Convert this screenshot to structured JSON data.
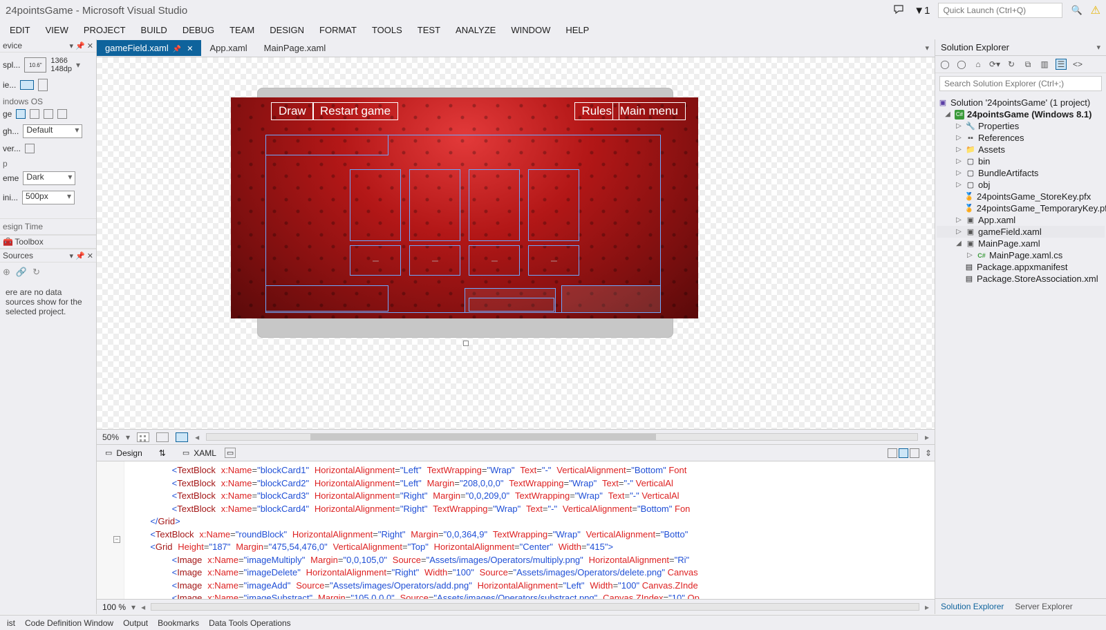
{
  "title": "24pointsGame - Microsoft Visual Studio",
  "quicklaunch_placeholder": "Quick Launch (Ctrl+Q)",
  "notifications": "1",
  "menus": [
    "EDIT",
    "VIEW",
    "PROJECT",
    "BUILD",
    "DEBUG",
    "TEAM",
    "DESIGN",
    "FORMAT",
    "TOOLS",
    "TEST",
    "ANALYZE",
    "WINDOW",
    "HELP"
  ],
  "doctabs": [
    {
      "label": "gameField.xaml",
      "active": true
    },
    {
      "label": "App.xaml",
      "active": false
    },
    {
      "label": "MainPage.xaml",
      "active": false
    }
  ],
  "left": {
    "device_hdr": "evice",
    "display_label": "spl...",
    "device_size": "10.6\"",
    "device_res": "1366",
    "device_dp": "148dp",
    "orient_label": "ie...",
    "os_hdr": "indows OS",
    "edge_label": "ge",
    "high_label": "gh...",
    "high_value": "Default",
    "over_label": "ver...",
    "app_hdr": "p",
    "theme_label": "eme",
    "theme_value": "Dark",
    "min_label": "ini...",
    "min_value": "500px",
    "design_hdr": "esign Time",
    "toolbox_label": "Toolbox",
    "sources_hdr": "Sources",
    "sources_msg": "ere are no data sources show for the selected project."
  },
  "game": {
    "draw": "Draw",
    "restart": "Restart game",
    "rules": "Rules",
    "mainmenu": "Main menu"
  },
  "zoom": {
    "pct": "50%"
  },
  "split": {
    "design": "Design",
    "xaml": "XAML"
  },
  "codebtm_pct": "100 %",
  "xaml_lines": [
    {
      "indent": 8,
      "el": "TextBlock",
      "attrs": [
        [
          "x:Name",
          "blockCard1"
        ],
        [
          "HorizontalAlignment",
          "Left"
        ],
        [
          "TextWrapping",
          "Wrap"
        ],
        [
          "Text",
          "-"
        ],
        [
          "VerticalAlignment",
          "Bottom"
        ]
      ],
      "tail": " Font"
    },
    {
      "indent": 8,
      "el": "TextBlock",
      "attrs": [
        [
          "x:Name",
          "blockCard2"
        ],
        [
          "HorizontalAlignment",
          "Left"
        ],
        [
          "Margin",
          "208,0,0,0"
        ],
        [
          "TextWrapping",
          "Wrap"
        ],
        [
          "Text",
          "-"
        ]
      ],
      "tail": " VerticalAl"
    },
    {
      "indent": 8,
      "el": "TextBlock",
      "attrs": [
        [
          "x:Name",
          "blockCard3"
        ],
        [
          "HorizontalAlignment",
          "Right"
        ],
        [
          "Margin",
          "0,0,209,0"
        ],
        [
          "TextWrapping",
          "Wrap"
        ],
        [
          "Text",
          "-"
        ]
      ],
      "tail": " VerticalAl"
    },
    {
      "indent": 8,
      "el": "TextBlock",
      "attrs": [
        [
          "x:Name",
          "blockCard4"
        ],
        [
          "HorizontalAlignment",
          "Right"
        ],
        [
          "TextWrapping",
          "Wrap"
        ],
        [
          "Text",
          "-"
        ],
        [
          "VerticalAlignment",
          "Bottom"
        ]
      ],
      "tail": " Fon"
    },
    {
      "indent": 4,
      "close": "Grid"
    },
    {
      "indent": 4,
      "el": "TextBlock",
      "attrs": [
        [
          "x:Name",
          "roundBlock"
        ],
        [
          "HorizontalAlignment",
          "Right"
        ],
        [
          "Margin",
          "0,0,364,9"
        ],
        [
          "TextWrapping",
          "Wrap"
        ],
        [
          "VerticalAlignment",
          "Botto"
        ]
      ],
      "tail": ""
    },
    {
      "indent": 4,
      "el": "Grid",
      "attrs": [
        [
          "Height",
          "187"
        ],
        [
          "Margin",
          "475,54,476,0"
        ],
        [
          "VerticalAlignment",
          "Top"
        ],
        [
          "HorizontalAlignment",
          "Center"
        ],
        [
          "Width",
          "415"
        ]
      ],
      "open": true
    },
    {
      "indent": 8,
      "el": "Image",
      "attrs": [
        [
          "x:Name",
          "imageMultiply"
        ],
        [
          "Margin",
          "0,0,105,0"
        ],
        [
          "Source",
          "Assets/images/Operators/multiply.png"
        ],
        [
          "HorizontalAlignment",
          "Ri"
        ]
      ],
      "tail": ""
    },
    {
      "indent": 8,
      "el": "Image",
      "attrs": [
        [
          "x:Name",
          "imageDelete"
        ],
        [
          "HorizontalAlignment",
          "Right"
        ],
        [
          "Width",
          "100"
        ],
        [
          "Source",
          "Assets/images/Operators/delete.png"
        ]
      ],
      "tail": " Canvas"
    },
    {
      "indent": 8,
      "el": "Image",
      "attrs": [
        [
          "x:Name",
          "imageAdd"
        ],
        [
          "Source",
          "Assets/images/Operators/add.png"
        ],
        [
          "HorizontalAlignment",
          "Left"
        ],
        [
          "Width",
          "100"
        ]
      ],
      "tail": " Canvas.ZInde"
    },
    {
      "indent": 8,
      "el": "Image",
      "attrs": [
        [
          "x:Name",
          "imageSubstract"
        ],
        [
          "Margin",
          "105,0,0,0"
        ],
        [
          "Source",
          "Assets/images/Operators/substract.png"
        ],
        [
          "Canvas.ZIndex",
          "10"
        ]
      ],
      "tail": " Op"
    }
  ],
  "se": {
    "title": "Solution Explorer",
    "search_placeholder": "Search Solution Explorer (Ctrl+;)",
    "solution": "Solution '24pointsGame' (1 project)",
    "project": "24pointsGame (Windows 8.1)",
    "nodes": {
      "properties": "Properties",
      "references": "References",
      "assets": "Assets",
      "bin": "bin",
      "bundle": "BundleArtifacts",
      "obj": "obj",
      "storekey": "24pointsGame_StoreKey.pfx",
      "tempkey": "24pointsGame_TemporaryKey.pfx",
      "appxaml": "App.xaml",
      "gamefield": "gameField.xaml",
      "mainpage": "MainPage.xaml",
      "mainpagecs": "MainPage.xaml.cs",
      "manifest": "Package.appxmanifest",
      "storeassoc": "Package.StoreAssociation.xml"
    },
    "bottom_tabs": [
      "Solution Explorer",
      "Server Explorer"
    ]
  },
  "status_items": [
    "ist",
    "Code Definition Window",
    "Output",
    "Bookmarks",
    "Data Tools Operations"
  ]
}
